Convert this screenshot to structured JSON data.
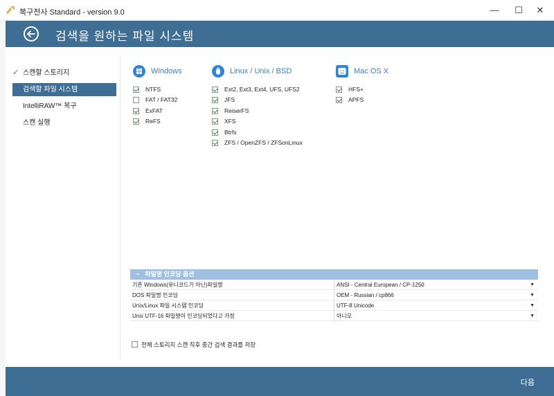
{
  "window": {
    "title": "복구전사 Standard - version 9.0",
    "minimize": "—",
    "maximize": "☐",
    "close": "✕"
  },
  "header": {
    "title": "검색을 원하는 파일 시스템"
  },
  "sidebar": {
    "items": [
      {
        "label": "스캔할 스토리지",
        "done": true
      },
      {
        "label": "검색할 파일 시스템",
        "active": true
      },
      {
        "label": "IntelliRAW™ 복구"
      },
      {
        "label": "스캔 실행"
      }
    ]
  },
  "filesystems": {
    "windows": {
      "label": "Windows",
      "icon": "windows-icon",
      "items": [
        {
          "label": "NTFS",
          "checked": true
        },
        {
          "label": "FAT / FAT32",
          "checked": false
        },
        {
          "label": "ExFAT",
          "checked": true
        },
        {
          "label": "ReFS",
          "checked": true
        }
      ]
    },
    "linux": {
      "label": "Linux / Unix / BSD",
      "icon": "linux-icon",
      "items": [
        {
          "label": "Ext2, Ext3, Ext4, UFS, UFS2",
          "checked": true
        },
        {
          "label": "JFS",
          "checked": true
        },
        {
          "label": "ReiserFS",
          "checked": true
        },
        {
          "label": "XFS",
          "checked": true
        },
        {
          "label": "Btrfs",
          "checked": true
        },
        {
          "label": "ZFS / OpenZFS / ZFSonLinux",
          "checked": true
        }
      ]
    },
    "mac": {
      "label": "Mac OS X",
      "icon": "finder-icon",
      "items": [
        {
          "label": "HFS+",
          "checked": true
        },
        {
          "label": "APFS",
          "checked": true
        }
      ]
    }
  },
  "encoding": {
    "title": "파일명 인코딩 옵션",
    "rows": [
      {
        "label": "기존 Windows(유니코드가 아닌)파일명",
        "value": "ANSI - Central European / CP-1250"
      },
      {
        "label": "DOS 파일명 인코딩",
        "value": "OEM - Russian / cp866"
      },
      {
        "label": "Unix/Linux 파일 시스템 인코딩",
        "value": "UTF-8 Unicode"
      },
      {
        "label": "Unix UTF-16 파일명이 인코딩되었다고 가정",
        "value": "아니오"
      }
    ]
  },
  "save_option": {
    "label": "전체 스토리지 스캔 직후 중간 검색 결과를 저장",
    "checked": false
  },
  "footer": {
    "next_label": "다음"
  },
  "colors": {
    "accent": "#3f6e95",
    "link": "#3a7fc4",
    "section_header": "#9fc0e0"
  }
}
